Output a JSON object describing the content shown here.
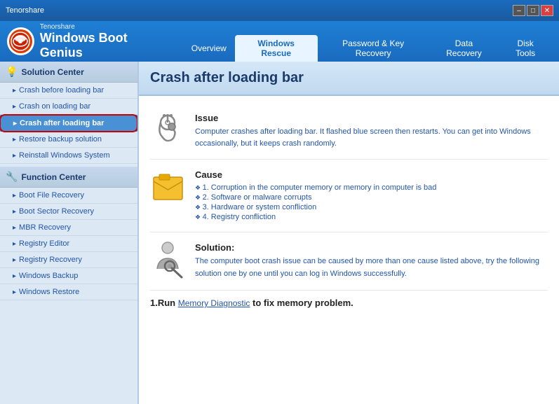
{
  "titlebar": {
    "app_name": "Windows Boot Genius",
    "company": "Tenorshare",
    "min_label": "–",
    "max_label": "□",
    "close_label": "✕"
  },
  "nav": {
    "tabs": [
      {
        "id": "overview",
        "label": "Overview",
        "active": false
      },
      {
        "id": "windows-rescue",
        "label": "Windows Rescue",
        "active": true
      },
      {
        "id": "password-recovery",
        "label": "Password & Key Recovery",
        "active": false
      },
      {
        "id": "data-recovery",
        "label": "Data Recovery",
        "active": false
      },
      {
        "id": "disk-tools",
        "label": "Disk Tools",
        "active": false
      }
    ]
  },
  "sidebar": {
    "solution_center_label": "Solution Center",
    "items": [
      {
        "id": "crash-before",
        "label": "Crash before loading bar",
        "active": false
      },
      {
        "id": "crash-on",
        "label": "Crash on loading bar",
        "active": false
      },
      {
        "id": "crash-after",
        "label": "Crash after loading bar",
        "active": true
      },
      {
        "id": "restore-backup",
        "label": "Restore backup solution",
        "active": false
      },
      {
        "id": "reinstall-windows",
        "label": "Reinstall Windows System",
        "active": false
      }
    ],
    "function_center_label": "Function Center",
    "function_items": [
      {
        "id": "boot-file",
        "label": "Boot File Recovery"
      },
      {
        "id": "boot-sector",
        "label": "Boot Sector Recovery"
      },
      {
        "id": "mbr-recovery",
        "label": "MBR Recovery"
      },
      {
        "id": "registry-editor",
        "label": "Registry Editor"
      },
      {
        "id": "registry-recovery",
        "label": "Registry Recovery"
      },
      {
        "id": "windows-backup",
        "label": "Windows Backup"
      },
      {
        "id": "windows-restore",
        "label": "Windows Restore"
      }
    ]
  },
  "content": {
    "title": "Crash after loading bar",
    "issue_label": "Issue",
    "issue_text": "Computer crashes after loading bar. It flashed blue screen then restarts. You can get into Windows occasionally, but it keeps crash randomly.",
    "cause_label": "Cause",
    "cause_items": [
      "1. Corruption in the computer memory or memory in computer is bad",
      "2. Software or malware corrupts",
      "3. Hardware or system confliction",
      "4. Registry confliction"
    ],
    "solution_label": "Solution:",
    "solution_text": "The computer boot crash issue can be caused by more than one cause listed above, try the following solution one by one until you can log in Windows successfully.",
    "bottom_heading": "1.Run ",
    "bottom_link": "Memory Diagnostic",
    "bottom_suffix": " to fix memory problem."
  }
}
